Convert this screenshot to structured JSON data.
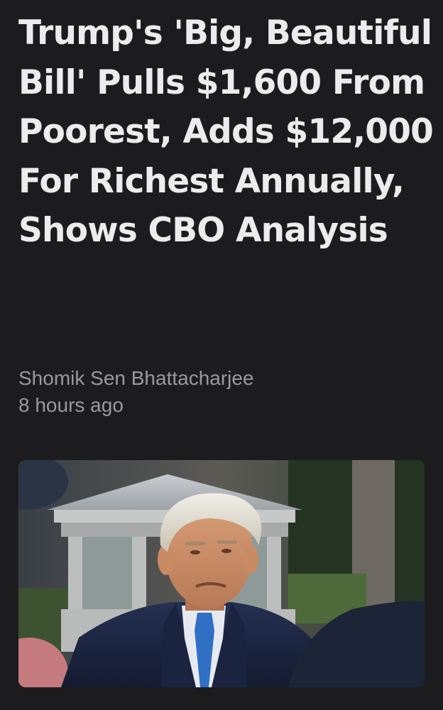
{
  "article": {
    "headline": "Trump's 'Big, Beautiful Bill' Pulls $1,600 From Poorest, Adds $12,000 For Richest Annually, Shows CBO Analysis",
    "author": "Shomik Sen Bhattacharjee",
    "timestamp": "8 hours ago",
    "image": {
      "subject": "photo-of-man-in-suit-with-blue-tie"
    }
  },
  "colors": {
    "background": "#1c1c1e",
    "headline_text": "#ececec",
    "meta_text": "#9a9a9e"
  }
}
